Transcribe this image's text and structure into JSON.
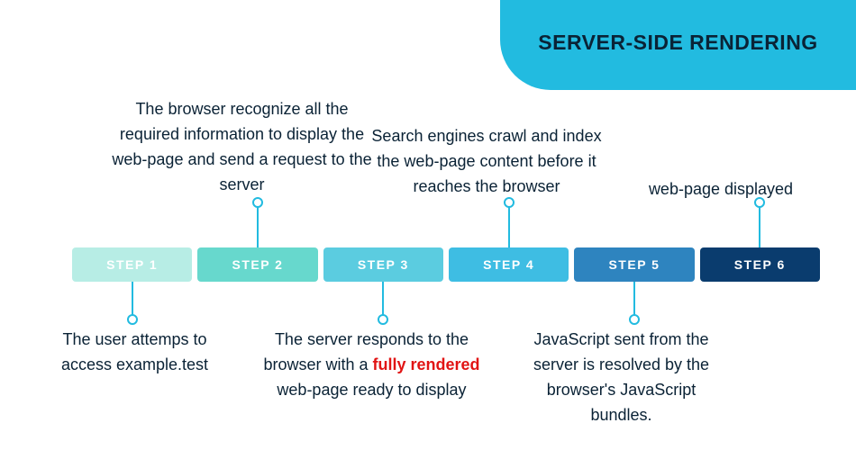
{
  "title": "SERVER-SIDE RENDERING",
  "steps": [
    {
      "label": "STEP 1",
      "color": "#b7ede5",
      "position": "below",
      "desc_before": "The user attemps to access example.test",
      "desc_hl": "",
      "desc_after": ""
    },
    {
      "label": "STEP 2",
      "color": "#67d8cd",
      "position": "above",
      "desc_before": "The browser recognize all the required information to display the web-page and send a request to the server",
      "desc_hl": "",
      "desc_after": ""
    },
    {
      "label": "STEP 3",
      "color": "#5bcce0",
      "position": "below",
      "desc_before": "The server responds to the browser with a ",
      "desc_hl": "fully rendered",
      "desc_after": " web-page ready to display"
    },
    {
      "label": "STEP 4",
      "color": "#3ebde3",
      "position": "above",
      "desc_before": "Search engines crawl and index the web-page content before it reaches the browser",
      "desc_hl": "",
      "desc_after": ""
    },
    {
      "label": "STEP 5",
      "color": "#2e84bf",
      "position": "below",
      "desc_before": "JavaScript sent from the server is resolved by the browser's JavaScript bundles.",
      "desc_hl": "",
      "desc_after": ""
    },
    {
      "label": "STEP 6",
      "color": "#0a3c6e",
      "position": "above",
      "desc_before": "web-page displayed",
      "desc_hl": "",
      "desc_after": ""
    }
  ],
  "layout": {
    "timelineTop": 275,
    "timelineLeft": 80,
    "timelineWidth": 830,
    "brickHeight": 38,
    "brickGap": 6,
    "above": [
      {
        "i": 1,
        "capLeft": 116,
        "capTop": 108,
        "capWidth": 305,
        "connTop": 225,
        "connHeight": 50
      },
      {
        "i": 3,
        "capLeft": 400,
        "capTop": 138,
        "capWidth": 280,
        "connTop": 225,
        "connHeight": 50
      },
      {
        "i": 5,
        "capLeft": 700,
        "capTop": 197,
        "capWidth": 200,
        "connTop": 225,
        "connHeight": 50
      }
    ],
    "below": [
      {
        "i": 0,
        "capLeft": 42,
        "capTop": 364,
        "capWidth": 215,
        "connTop": 313,
        "connHeight": 42
      },
      {
        "i": 2,
        "capLeft": 275,
        "capTop": 364,
        "capWidth": 275,
        "connTop": 313,
        "connHeight": 42
      },
      {
        "i": 4,
        "capLeft": 572,
        "capTop": 364,
        "capWidth": 235,
        "connTop": 313,
        "connHeight": 42
      }
    ]
  }
}
